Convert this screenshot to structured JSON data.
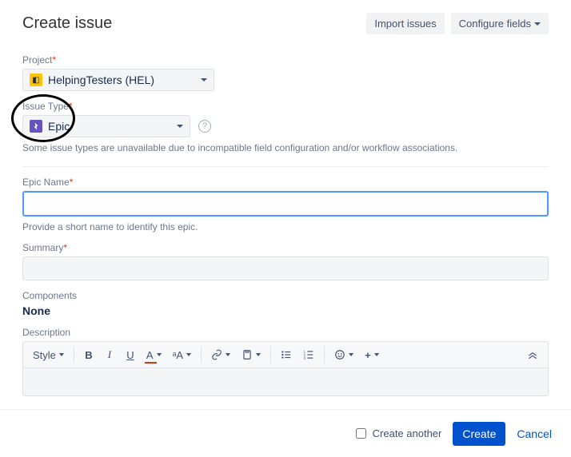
{
  "header": {
    "title": "Create issue",
    "import_btn": "Import issues",
    "configure_btn": "Configure fields"
  },
  "fields": {
    "project": {
      "label": "Project",
      "value": "HelpingTesters (HEL)"
    },
    "issue_type": {
      "label": "Issue Type",
      "value": "Epic",
      "hint": "Some issue types are unavailable due to incompatible field configuration and/or workflow associations."
    },
    "epic_name": {
      "label": "Epic Name",
      "value": "",
      "hint": "Provide a short name to identify this epic."
    },
    "summary": {
      "label": "Summary",
      "value": ""
    },
    "components": {
      "label": "Components",
      "value": "None"
    },
    "description": {
      "label": "Description"
    }
  },
  "rte": {
    "style": "Style",
    "size": "ᵃA"
  },
  "footer": {
    "create_another": "Create another",
    "create": "Create",
    "cancel": "Cancel"
  }
}
